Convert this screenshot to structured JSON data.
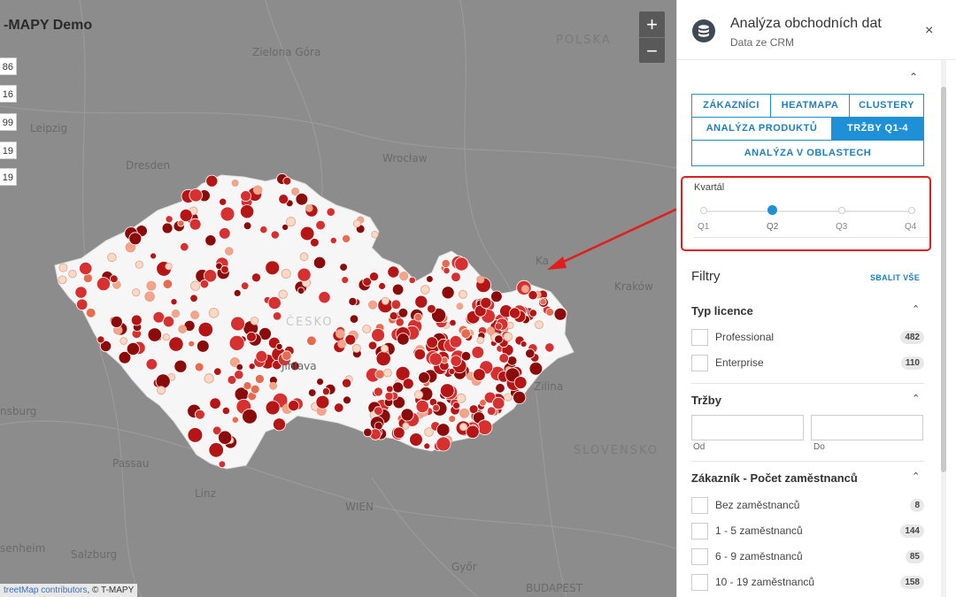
{
  "map": {
    "title": "-MAPY Demo",
    "badges": [
      "86",
      "16",
      "99",
      "19",
      "19"
    ],
    "zoom_in": "+",
    "zoom_out": "−",
    "attribution_link": "treetMap contributors",
    "attribution_rest": ", © T-MAPY",
    "cities": [
      {
        "name": "Zielona Góra"
      },
      {
        "name": "Leipzig"
      },
      {
        "name": "Dresden"
      },
      {
        "name": "Wrocław"
      },
      {
        "name": "Kraków"
      },
      {
        "name": "Jihlava"
      },
      {
        "name": "Zilina"
      },
      {
        "name": "Passau"
      },
      {
        "name": "Linz"
      },
      {
        "name": "WIEN"
      },
      {
        "name": "Salzburg"
      },
      {
        "name": "Győr"
      },
      {
        "name": "BUDAPEST"
      },
      {
        "name": "nsburg"
      },
      {
        "name": "senheim"
      },
      {
        "name": "Ka"
      }
    ],
    "countries": [
      {
        "name": "POLSKA"
      },
      {
        "name": "SLOVENSKO"
      },
      {
        "name": "ČESKO"
      }
    ],
    "marker_colors": [
      "#8b0a0a",
      "#b51515",
      "#d63030",
      "#e86b50",
      "#f2a58a",
      "#fbd9c7"
    ]
  },
  "panel": {
    "title": "Analýza obchodních dat",
    "subtitle": "Data ze CRM",
    "close": "×",
    "collapse": "⌃",
    "tabs": [
      {
        "label": "ZÁKAZNÍCI",
        "active": false
      },
      {
        "label": "HEATMAPA",
        "active": false
      },
      {
        "label": "CLUSTERY",
        "active": false
      },
      {
        "label": "ANALÝZA PRODUKTŮ",
        "active": false
      },
      {
        "label": "TRŽBY Q1-4",
        "active": true
      },
      {
        "label": "ANALÝZA V OBLASTECH",
        "active": false
      }
    ],
    "quarter": {
      "label": "Kvartál",
      "ticks": [
        "Q1",
        "Q2",
        "Q3",
        "Q4"
      ],
      "selected": "Q2"
    },
    "filters": {
      "title": "Filtry",
      "collapse_all": "SBALIT VŠE",
      "licence": {
        "title": "Typ licence",
        "items": [
          {
            "label": "Professional",
            "count": "482"
          },
          {
            "label": "Enterprise",
            "count": "110"
          }
        ]
      },
      "revenue": {
        "title": "Tržby",
        "from_label": "Od",
        "to_label": "Do"
      },
      "employees": {
        "title": "Zákazník - Počet zaměstnanců",
        "items": [
          {
            "label": "Bez zaměstnanců",
            "count": "8"
          },
          {
            "label": "1 - 5 zaměstnanců",
            "count": "144"
          },
          {
            "label": "6 - 9 zaměstnanců",
            "count": "85"
          },
          {
            "label": "10 - 19 zaměstnanců",
            "count": "158"
          }
        ]
      }
    }
  }
}
